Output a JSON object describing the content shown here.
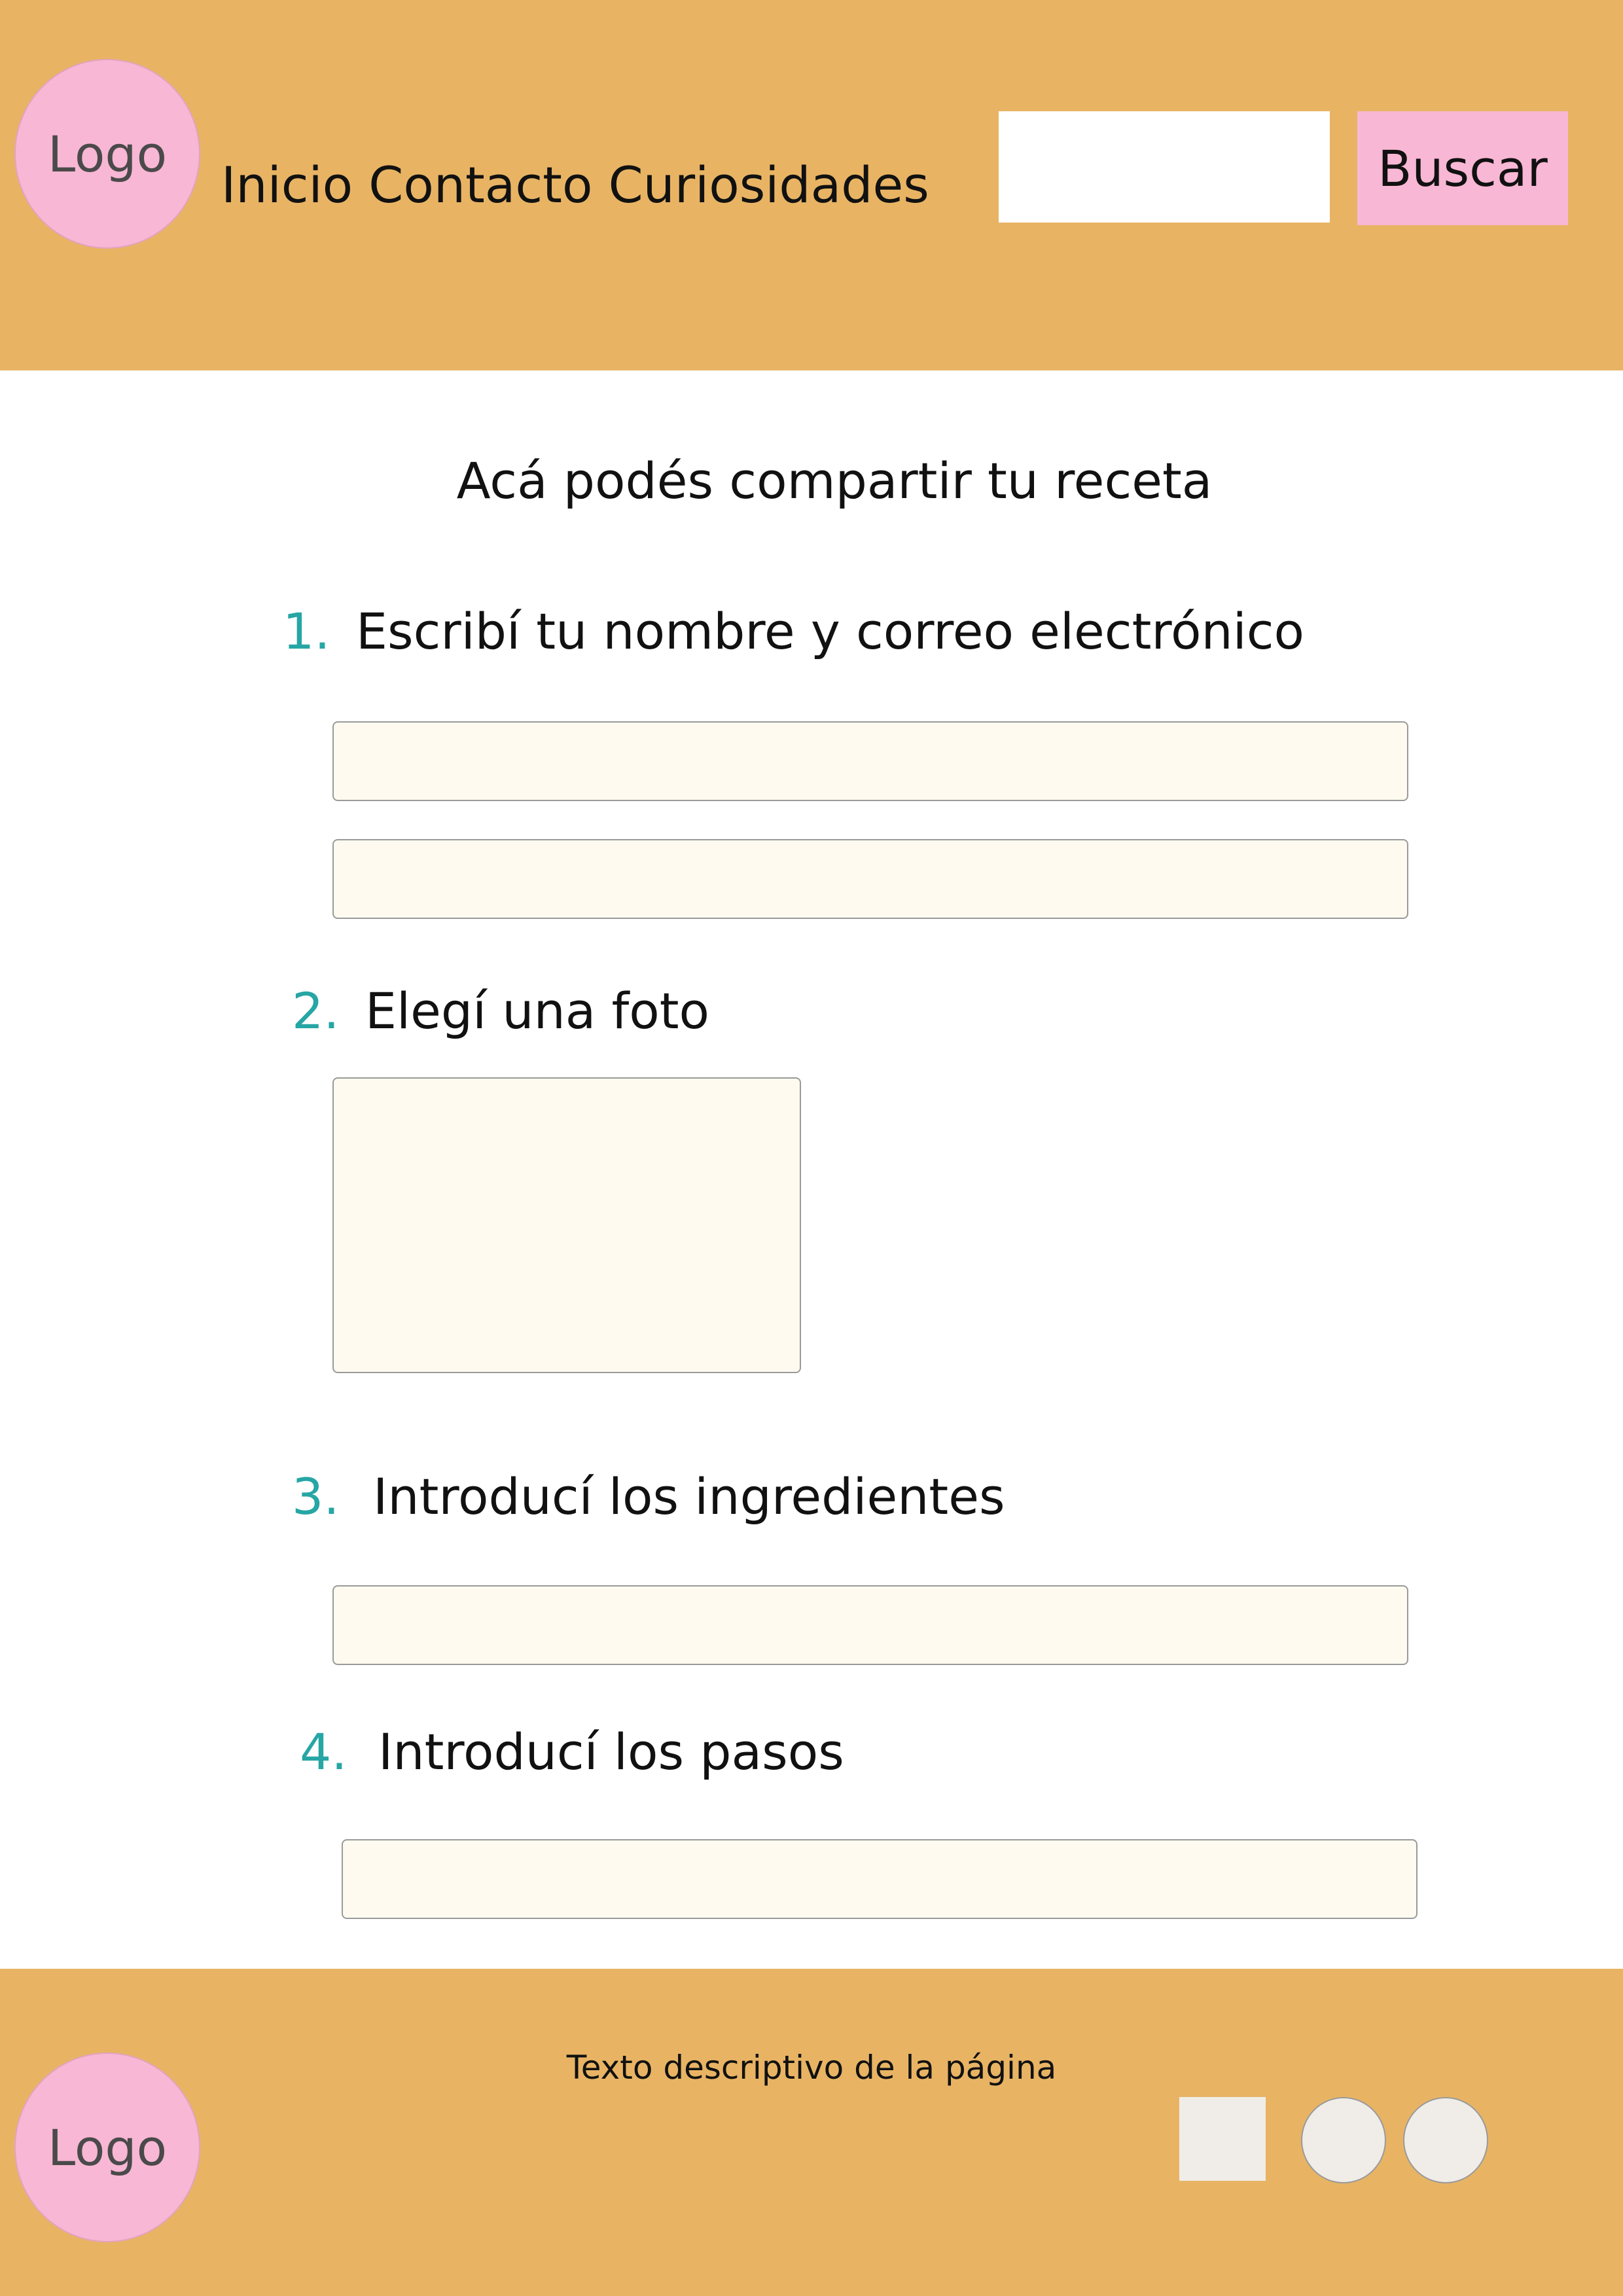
{
  "header": {
    "logo_label": "Logo",
    "nav_label": "Inicio Contacto Curiosidades",
    "search": {
      "value": "",
      "placeholder": "",
      "button_label": "Buscar"
    }
  },
  "main": {
    "title": "Acá podés compartir tu receta",
    "steps": [
      {
        "number": "1.",
        "label": "Escribí tu nombre y correo electrónico"
      },
      {
        "number": "2.",
        "label": "Elegí una foto"
      },
      {
        "number": "3.",
        "label": "Introducí los ingredientes"
      },
      {
        "number": "4.",
        "label": "Introducí los pasos"
      }
    ]
  },
  "footer": {
    "logo_label": "Logo",
    "description": "Texto descriptivo de la página"
  },
  "colors": {
    "header_background": "#e8b464",
    "logo_pink": "#f8b7d4",
    "step_number": "#26a6a4",
    "field_background": "#fefaf0"
  },
  "icons": [
    "square-social-icon",
    "circle-social-icon",
    "circle-social-icon"
  ]
}
